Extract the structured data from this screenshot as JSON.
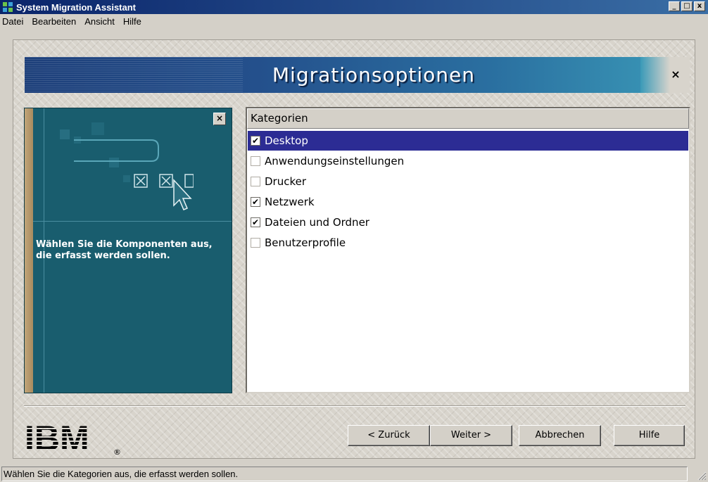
{
  "window": {
    "title": "System Migration Assistant",
    "controls": [
      "_",
      "□",
      "x"
    ]
  },
  "menu": {
    "items": [
      "Datei",
      "Bearbeiten",
      "Ansicht",
      "Hilfe"
    ]
  },
  "banner": {
    "title": "Migrationsoptionen",
    "close_label": "×"
  },
  "info_panel": {
    "close_label": "×",
    "text": "Wählen Sie die Komponenten aus, die erfasst werden sollen."
  },
  "categories": {
    "header": "Kategorien",
    "items": [
      {
        "label": "Desktop",
        "checked": true,
        "selected": true
      },
      {
        "label": "Anwendungseinstellungen",
        "checked": false,
        "selected": false
      },
      {
        "label": "Drucker",
        "checked": false,
        "selected": false
      },
      {
        "label": "Netzwerk",
        "checked": true,
        "selected": false
      },
      {
        "label": "Dateien und Ordner",
        "checked": true,
        "selected": false
      },
      {
        "label": "Benutzerprofile",
        "checked": false,
        "selected": false
      }
    ]
  },
  "buttons": {
    "back": "< Zurück",
    "next": "Weiter >",
    "cancel": "Abbrechen",
    "help": "Hilfe"
  },
  "logo": {
    "text": "IBM",
    "registered": "®"
  },
  "statusbar": {
    "text": "Wählen Sie die Kategorien aus, die erfasst werden sollen."
  },
  "colors": {
    "titlebar": "#0a246a",
    "selection": "#2c2c94",
    "info_panel": "#195d6e"
  }
}
